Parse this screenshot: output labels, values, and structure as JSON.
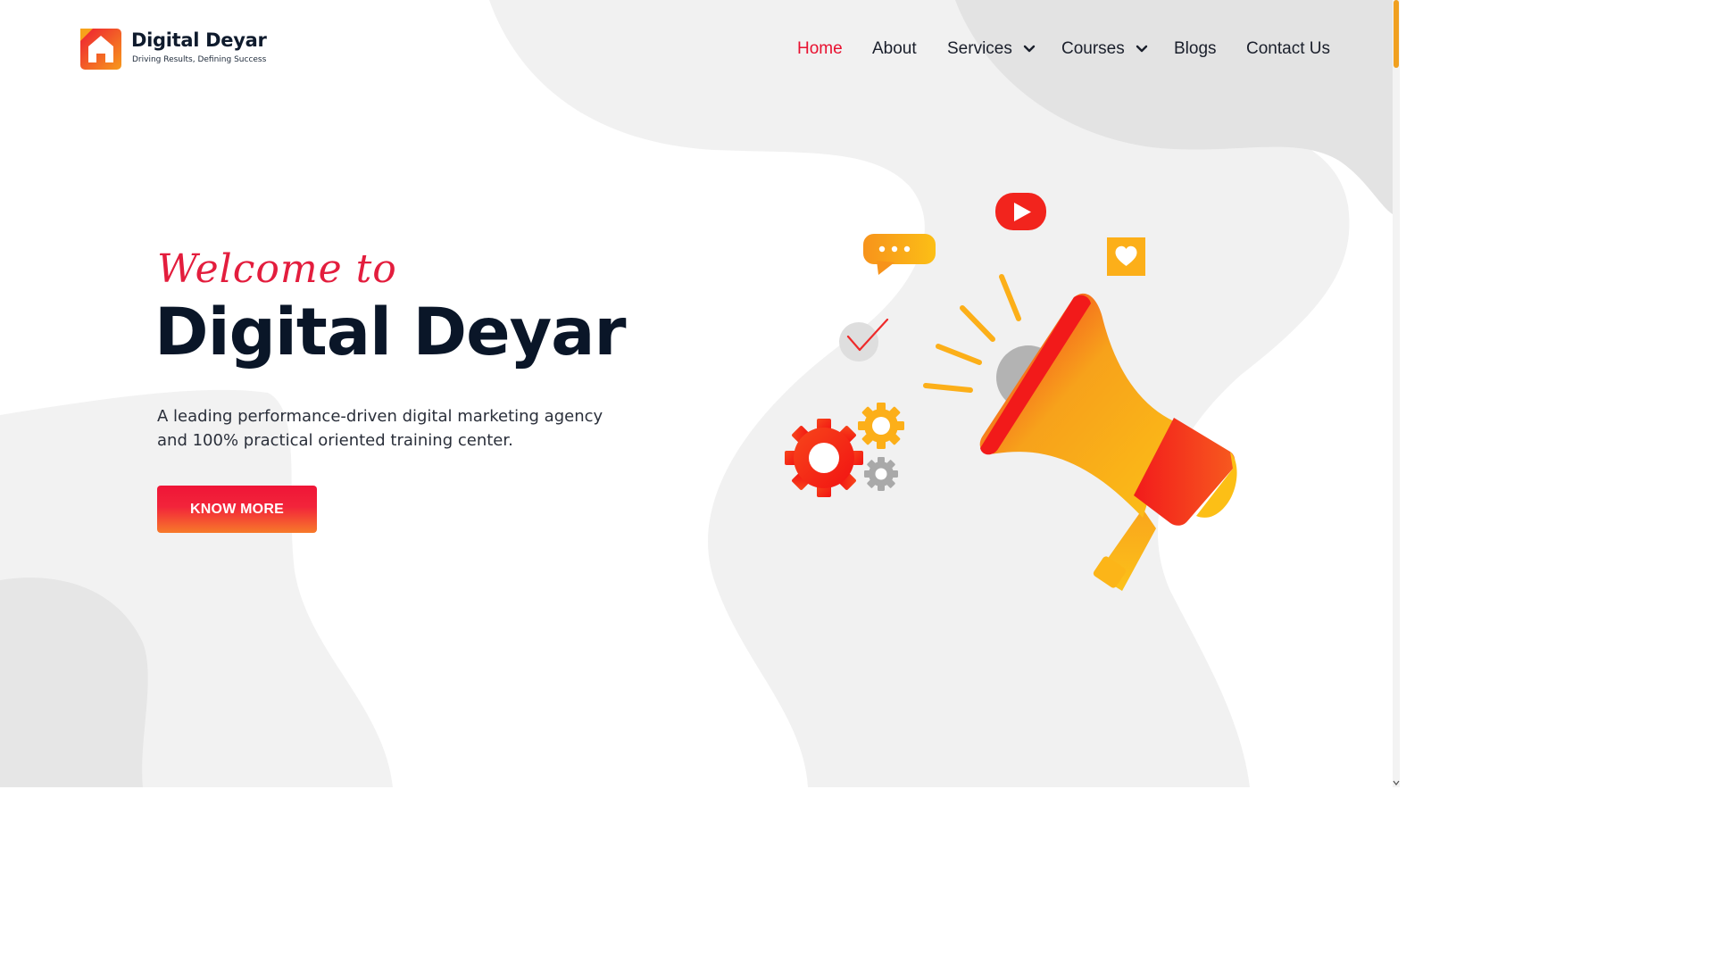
{
  "brand": {
    "name": "Digital Deyar",
    "tagline": "Driving Results, Defining Success"
  },
  "nav": {
    "items": [
      {
        "label": "Home",
        "active": true,
        "has_dropdown": false
      },
      {
        "label": "About",
        "active": false,
        "has_dropdown": false
      },
      {
        "label": "Services",
        "active": false,
        "has_dropdown": true
      },
      {
        "label": "Courses",
        "active": false,
        "has_dropdown": true
      },
      {
        "label": "Blogs",
        "active": false,
        "has_dropdown": false
      },
      {
        "label": "Contact Us",
        "active": false,
        "has_dropdown": false
      }
    ]
  },
  "hero": {
    "script_heading": "Welcome to",
    "title": "Digital Deyar",
    "description": "A leading performance-driven digital marketing agency and 100% practical oriented training center.",
    "button_label": "KNOW MORE"
  },
  "illustration": {
    "icons": [
      "megaphone-icon",
      "youtube-play-icon",
      "chat-bubble-icon",
      "heart-icon",
      "checkmark-icon",
      "gear-icon"
    ]
  },
  "colors": {
    "accent_red": "#e8102f",
    "accent_orange": "#f7a21b",
    "navy": "#0a1628",
    "blob_gray": "#f1f1f1"
  }
}
